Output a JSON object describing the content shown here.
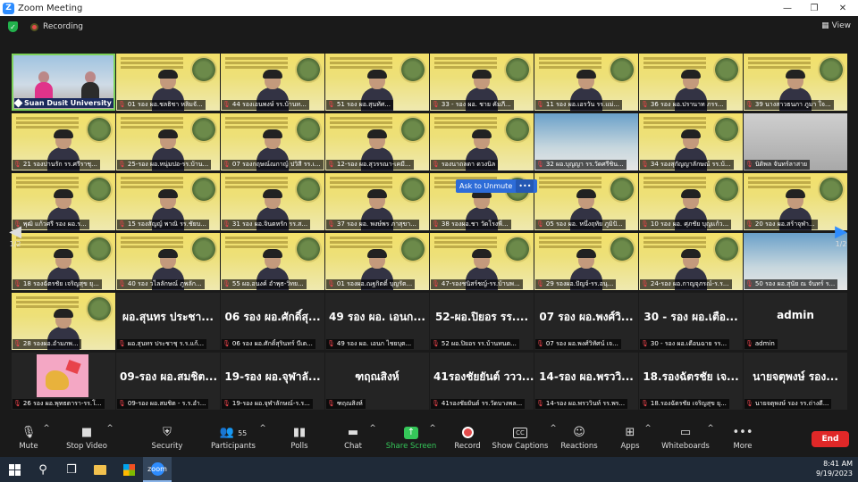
{
  "window": {
    "title": "Zoom Meeting",
    "controls": [
      "—",
      "❐",
      "✕"
    ]
  },
  "status": {
    "recording": "Recording",
    "view": "View"
  },
  "host_tile": {
    "label": "Suan Dusit University"
  },
  "tiles": [
    {
      "kind": "slide",
      "label": "01 รอง ผอ.ชลธิชา หลิมจั..."
    },
    {
      "kind": "slide",
      "label": "44 รองเอนพงษ์ รร.บ้านท..."
    },
    {
      "kind": "slide",
      "label": "51     รอง ผอ.สุนทัศ..."
    },
    {
      "kind": "slide",
      "label": "33 - รอง ผอ. ชาย คัมภี..."
    },
    {
      "kind": "slide",
      "label": "11 รอง ผอ.เอรวัน รร.แม่..."
    },
    {
      "kind": "slide",
      "label": "36 รอง ผอ.ปรานาท ภรร..."
    },
    {
      "kind": "slide",
      "label": "39 นางสาวธนภา ภูมา ใจ..."
    },
    {
      "kind": "slide",
      "label": "21 รองปานรัก รร.ศรีราชุ..."
    },
    {
      "kind": "slide",
      "label": "25-รอง ผอ.หนุ่มปอ-รร.บ้าน..."
    },
    {
      "kind": "slide",
      "label": "07 รองกฤษณ์ณกาญ์ ปวิสี รร.เ..."
    },
    {
      "kind": "slide",
      "label": "12-รอง ผอ.สุวรรณา-เคมี..."
    },
    {
      "kind": "slide",
      "label": "รองนาถลดา ดวงนิล"
    },
    {
      "kind": "cam-room",
      "label": "32 ผอ.บุญญา รร.วัดศรีชิน..."
    },
    {
      "kind": "slide",
      "label": "34 รองสุกัญญาลักษณ์ รร.บ้..."
    },
    {
      "kind": "cam-gray",
      "label": "นิติพล จันทร์ลาสาย"
    },
    {
      "kind": "slide",
      "label": "พุฒิ แก้วศรี รอง ผอ.ร..."
    },
    {
      "kind": "slide",
      "label": "15 รองสัญญ์ พาณิ รร.ชัยบ..."
    },
    {
      "kind": "slide",
      "label": "31 รอง ผอ.จินตหรัก รร.ส..."
    },
    {
      "kind": "slide",
      "label": "37 รอง ผอ. พงษ์พร ภาสุขา..."
    },
    {
      "kind": "slide",
      "label": "38 รองผอ.ชา วัดโรงพี่..."
    },
    {
      "kind": "slide",
      "label": "05 รอง ผอ. หนึ่งฤทัย ภูมิปั..."
    },
    {
      "kind": "slide",
      "label": "10 รอง ผอ. ศุภชัย บุญแก้ว..."
    },
    {
      "kind": "slide",
      "label": "20 รอง ผอ.สร้าจุฬา..."
    },
    {
      "kind": "slide",
      "label": "18 รองฉัตรชัย เจริญสุข ยุ..."
    },
    {
      "kind": "slide",
      "label": "40 รอง วไลลักษณ์ ภูพลัก..."
    },
    {
      "kind": "slide",
      "label": "55 ผอ.อนงค์ อำพุธ-วิทย..."
    },
    {
      "kind": "slide",
      "label": "01 รองผอ.ณฐกิตติ์ บุญรัต..."
    },
    {
      "kind": "slide",
      "label": "47-รองชนิสร์ชญ์-รร.บ้านพ..."
    },
    {
      "kind": "slide",
      "label": "29 รองผอ.ปัญจ์-รร.อนุ..."
    },
    {
      "kind": "slide",
      "label": "24-รอง ผอ.กาญจุภรณ์-ร.ร..."
    },
    {
      "kind": "cam-room",
      "label": "50 รอง ผอ.สุนัย ณ จันทร์ ร..."
    },
    {
      "kind": "slide",
      "label": "28 รองผอ.อำมภพ..."
    }
  ],
  "name_tiles": [
    {
      "name": "ผอ.สุนทร ประชา...",
      "label": "ผอ.สุนทร ประชาชุ ร.ร.แก้..."
    },
    {
      "name": "06 รอง ผอ.ศักดิ์สุ...",
      "label": "06 รอง ผอ.ศักดิ์สุรินทร์ บีเต..."
    },
    {
      "name": "49 รอง ผอ. เอนก...",
      "label": "49 รอง ผอ. เอนก ไชยบุต..."
    },
    {
      "name": "52-ผอ.ปิยอร รร....",
      "label": "52 ผอ.ปิยอร รร.บ้านทนต..."
    },
    {
      "name": "07 รอง ผอ.พงศ์วิ...",
      "label": "07 รอง ผอ.พงศ์วิทัศน์ เจ..."
    },
    {
      "name": "30 - รอง ผอ.เตือ...",
      "label": "30 - รอง ผอ.เตือนฉาย รร..."
    },
    {
      "name": "admin",
      "label": "admin"
    },
    {
      "name": "",
      "label": "26 รอง ผอ.พุทธตารา-รร.โ..."
    },
    {
      "name": "09-รอง ผอ.สมชิต...",
      "label": "09-รอง ผอ.สมชิต - ร.ร.อำ..."
    },
    {
      "name": "19-รอง ผอ.จุฬาลั...",
      "label": "19-รอง ผอ.จุฬาลักษณ์-ร.ร..."
    },
    {
      "name": "ฑฤณสิงห์",
      "label": "ฑฤณสิงห์"
    },
    {
      "name": "41รองชัยยันต์ ววว...",
      "label": "41รองชัยยันต์ รร.วัดบางพล..."
    },
    {
      "name": "14-รอง ผอ.พรววิ...",
      "label": "14-รอง ผอ.พรววินท์ รร.พร..."
    },
    {
      "name": "18.รองฉัตรชัย เจ...",
      "label": "18.รองฉัตรชัย เจริญสุข ยุ..."
    },
    {
      "name": "นายจตุพงษ์ รอง...",
      "label": "นายจตุพงษ์ รอง รร.ถ่างดี..."
    }
  ],
  "ask_unmute": {
    "label": "Ask to Unmute",
    "more": "•••"
  },
  "pager": {
    "left": "1/2",
    "right": "1/2"
  },
  "toolbar": {
    "mute": "Mute",
    "stop_video": "Stop Video",
    "security": "Security",
    "participants": "Participants",
    "participants_count": "55",
    "polls": "Polls",
    "chat": "Chat",
    "share": "Share Screen",
    "record": "Record",
    "captions": "Show Captions",
    "captions_icon": "CC",
    "reactions": "Reactions",
    "apps": "Apps",
    "whiteboards": "Whiteboards",
    "more": "More",
    "end": "End"
  },
  "taskbar": {
    "time": "8:41 AM",
    "date": "9/19/2023",
    "zoom_icon": "zoom"
  },
  "colors": {
    "accent": "#2d8cff",
    "share_green": "#35c759",
    "end_red": "#e02828",
    "record_red": "#e34b4b"
  }
}
